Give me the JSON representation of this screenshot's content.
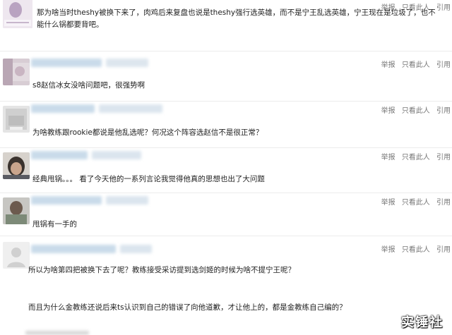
{
  "actions": {
    "report": "举报",
    "only_this": "只看此人",
    "quote": "引用"
  },
  "comments": [
    {
      "text": "那为啥当时theshy被换下来了，肉鸡后来复盘也说是theshy强行选英雄，而不是宁王乱选英雄，宁王现在是垃圾了，也不能什么锅都要背吧。"
    },
    {
      "text": "s8赵信冰女没啥问题吧，很强势啊"
    },
    {
      "text": "为啥教练跟rookie都说是他乱选呢？何况这个阵容选赵信不是很正常？"
    },
    {
      "text": "经典甩锅。。。 看了今天他的一系列言论我觉得他真的思想也出了大问题"
    },
    {
      "text": "甩锅有一手的"
    },
    {
      "text_1": "所以为啥第四把被换下去了呢？教练接受采访提到选剑姬的时候为啥不提宁王呢？",
      "text_2": "而且为什么金教练还说后来ts认识到自己的错误了向他道歉，才让他上的，都是金教练自己编的？"
    }
  ],
  "watermark": "实锤社"
}
